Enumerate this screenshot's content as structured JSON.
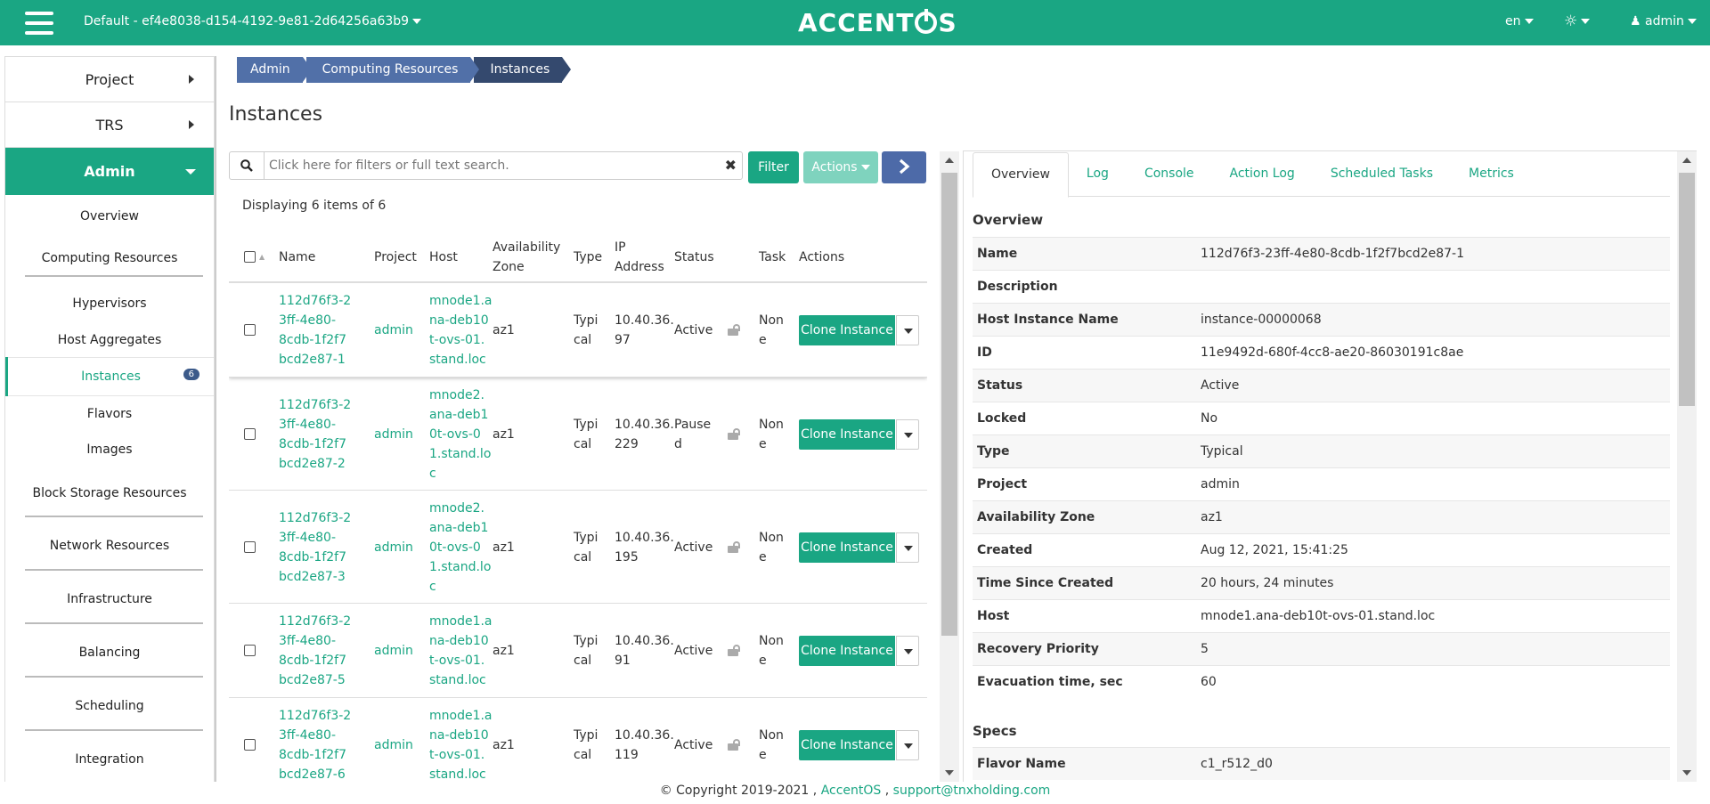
{
  "topbar": {
    "project": "Default - ef4e8038-d154-4192-9e81-2d64256a63b9",
    "brand": "ACCENTOS",
    "lang": "en",
    "user": "admin"
  },
  "sidebar": {
    "project": "Project",
    "trs": "TRS",
    "admin": "Admin",
    "items": [
      {
        "label": "Overview"
      },
      {
        "label": "Computing Resources"
      },
      {
        "label": "Hypervisors"
      },
      {
        "label": "Host Aggregates"
      },
      {
        "label": "Instances",
        "badge": "6"
      },
      {
        "label": "Flavors"
      },
      {
        "label": "Images"
      },
      {
        "label": "Block Storage Resources"
      },
      {
        "label": "Network Resources"
      },
      {
        "label": "Infrastructure"
      },
      {
        "label": "Balancing"
      },
      {
        "label": "Scheduling"
      },
      {
        "label": "Integration"
      }
    ]
  },
  "breadcrumb": [
    "Admin",
    "Computing Resources",
    "Instances"
  ],
  "page_title": "Instances",
  "search": {
    "placeholder": "Click here for filters or full text search."
  },
  "buttons": {
    "filter": "Filter",
    "actions": "Actions"
  },
  "displaying": "Displaying 6 items of 6",
  "table": {
    "columns": [
      "Name",
      "Project",
      "Host",
      "Availability Zone",
      "Type",
      "IP Address",
      "Status",
      "Task",
      "Actions"
    ],
    "col_labels": {
      "availability": [
        "Availability",
        "Zone"
      ],
      "ip": [
        "IP",
        "Address"
      ]
    },
    "clone_label": "Clone Instance",
    "rows": [
      {
        "name": [
          "112d76f3-2",
          "3ff-4e80-",
          "8cdb-1f2f7",
          "bcd2e87-1"
        ],
        "project": "admin",
        "host": [
          "mnode1.a",
          "na-deb10",
          "t-ovs-01.",
          "stand.loc"
        ],
        "az": "az1",
        "type": [
          "Typi",
          "cal"
        ],
        "ip": [
          "10.40.36.",
          "97"
        ],
        "status": [
          "Active"
        ],
        "task": [
          "Non",
          "e"
        ]
      },
      {
        "name": [
          "112d76f3-2",
          "3ff-4e80-",
          "8cdb-1f2f7",
          "bcd2e87-2"
        ],
        "project": "admin",
        "host": [
          "mnode2.",
          "ana-deb1",
          "0t-ovs-0",
          "1.stand.lo",
          "c"
        ],
        "az": "az1",
        "type": [
          "Typi",
          "cal"
        ],
        "ip": [
          "10.40.36.",
          "229"
        ],
        "status": [
          "Pause",
          "d"
        ],
        "task": [
          "Non",
          "e"
        ]
      },
      {
        "name": [
          "112d76f3-2",
          "3ff-4e80-",
          "8cdb-1f2f7",
          "bcd2e87-3"
        ],
        "project": "admin",
        "host": [
          "mnode2.",
          "ana-deb1",
          "0t-ovs-0",
          "1.stand.lo",
          "c"
        ],
        "az": "az1",
        "type": [
          "Typi",
          "cal"
        ],
        "ip": [
          "10.40.36.",
          "195"
        ],
        "status": [
          "Active"
        ],
        "task": [
          "Non",
          "e"
        ]
      },
      {
        "name": [
          "112d76f3-2",
          "3ff-4e80-",
          "8cdb-1f2f7",
          "bcd2e87-5"
        ],
        "project": "admin",
        "host": [
          "mnode1.a",
          "na-deb10",
          "t-ovs-01.",
          "stand.loc"
        ],
        "az": "az1",
        "type": [
          "Typi",
          "cal"
        ],
        "ip": [
          "10.40.36.",
          "91"
        ],
        "status": [
          "Active"
        ],
        "task": [
          "Non",
          "e"
        ]
      },
      {
        "name": [
          "112d76f3-2",
          "3ff-4e80-",
          "8cdb-1f2f7",
          "bcd2e87-6"
        ],
        "project": "admin",
        "host": [
          "mnode1.a",
          "na-deb10",
          "t-ovs-01.",
          "stand.loc"
        ],
        "az": "az1",
        "type": [
          "Typi",
          "cal"
        ],
        "ip": [
          "10.40.36.",
          "119"
        ],
        "status": [
          "Active"
        ],
        "task": [
          "Non",
          "e"
        ]
      }
    ]
  },
  "detail": {
    "tabs": [
      "Overview",
      "Log",
      "Console",
      "Action Log",
      "Scheduled Tasks",
      "Metrics"
    ],
    "overview_title": "Overview",
    "fields": [
      {
        "k": "Name",
        "v": "112d76f3-23ff-4e80-8cdb-1f2f7bcd2e87-1"
      },
      {
        "k": "Description",
        "v": ""
      },
      {
        "k": "Host Instance Name",
        "v": "instance-00000068"
      },
      {
        "k": "ID",
        "v": "11e9492d-680f-4cc8-ae20-86030191c8ae"
      },
      {
        "k": "Status",
        "v": "Active"
      },
      {
        "k": "Locked",
        "v": "No"
      },
      {
        "k": "Type",
        "v": "Typical"
      },
      {
        "k": "Project",
        "v": "admin"
      },
      {
        "k": "Availability Zone",
        "v": "az1"
      },
      {
        "k": "Created",
        "v": "Aug 12, 2021, 15:41:25"
      },
      {
        "k": "Time Since Created",
        "v": "20 hours, 24 minutes"
      },
      {
        "k": "Host",
        "v": "mnode1.ana-deb10t-ovs-01.stand.loc"
      },
      {
        "k": "Recovery Priority",
        "v": "5"
      },
      {
        "k": "Evacuation time, sec",
        "v": "60"
      }
    ],
    "specs_title": "Specs",
    "specs": [
      {
        "k": "Flavor Name",
        "v": "c1_r512_d0"
      }
    ]
  },
  "footer": {
    "copyright": "© Copyright 2019-2021 ,",
    "link1": "AccentOS",
    "sep": ",",
    "link2": "support@tnxholding.com"
  },
  "colors": {
    "accent": "#1aa683",
    "nav_blue": "#5170a8",
    "nav_dark": "#34496e"
  }
}
